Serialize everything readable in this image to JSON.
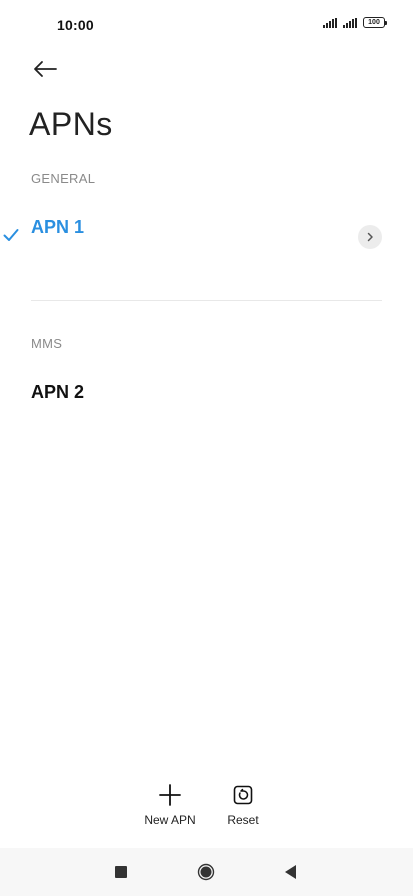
{
  "status_bar": {
    "time": "10:00",
    "battery": "100"
  },
  "title": "APNs",
  "sections": [
    {
      "header": "GENERAL",
      "items": [
        {
          "label": "APN 1",
          "selected": true
        }
      ]
    },
    {
      "header": "MMS",
      "items": [
        {
          "label": "APN 2",
          "selected": false
        }
      ]
    }
  ],
  "actions": {
    "new_apn_label": "New APN",
    "reset_label": "Reset"
  },
  "icons": {
    "back": "arrow-left-icon",
    "check": "check-icon",
    "chevron": "chevron-right-icon",
    "plus": "plus-icon",
    "reset": "reset-icon",
    "nav_recents": "square-icon",
    "nav_home": "circle-icon",
    "nav_back": "triangle-left-icon"
  },
  "colors": {
    "accent": "#2a8fe0",
    "section_header": "#8a8a8a",
    "nav_bar": "#f7f7f7"
  }
}
